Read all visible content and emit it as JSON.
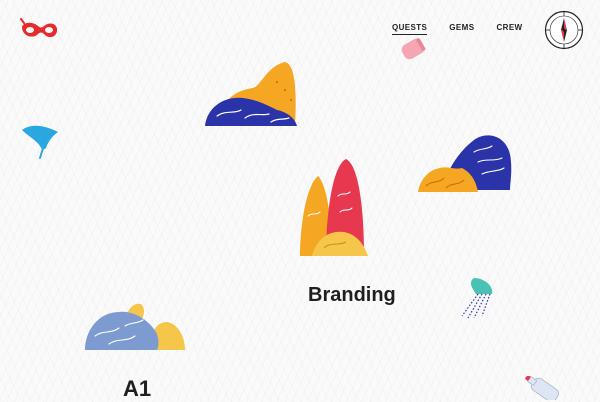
{
  "nav": {
    "items": [
      {
        "label": "QUESTS",
        "active": true
      },
      {
        "label": "GEMS",
        "active": false
      },
      {
        "label": "CREW",
        "active": false
      }
    ]
  },
  "projects": [
    {
      "title": "Branding"
    },
    {
      "title": "A1"
    }
  ],
  "colors": {
    "orange": "#f5a623",
    "navy": "#2a33a8",
    "red": "#e8384f",
    "yellow": "#f5c64a",
    "slate_blue": "#7e9bd1",
    "pink": "#f4a7b3",
    "teal": "#49c2b5",
    "sky": "#2aa6e0"
  },
  "icons": [
    "red-mask-logo-icon",
    "compass-icon",
    "pink-jar-icon",
    "stingray-icon",
    "jellyfish-icon",
    "bottle-icon"
  ]
}
